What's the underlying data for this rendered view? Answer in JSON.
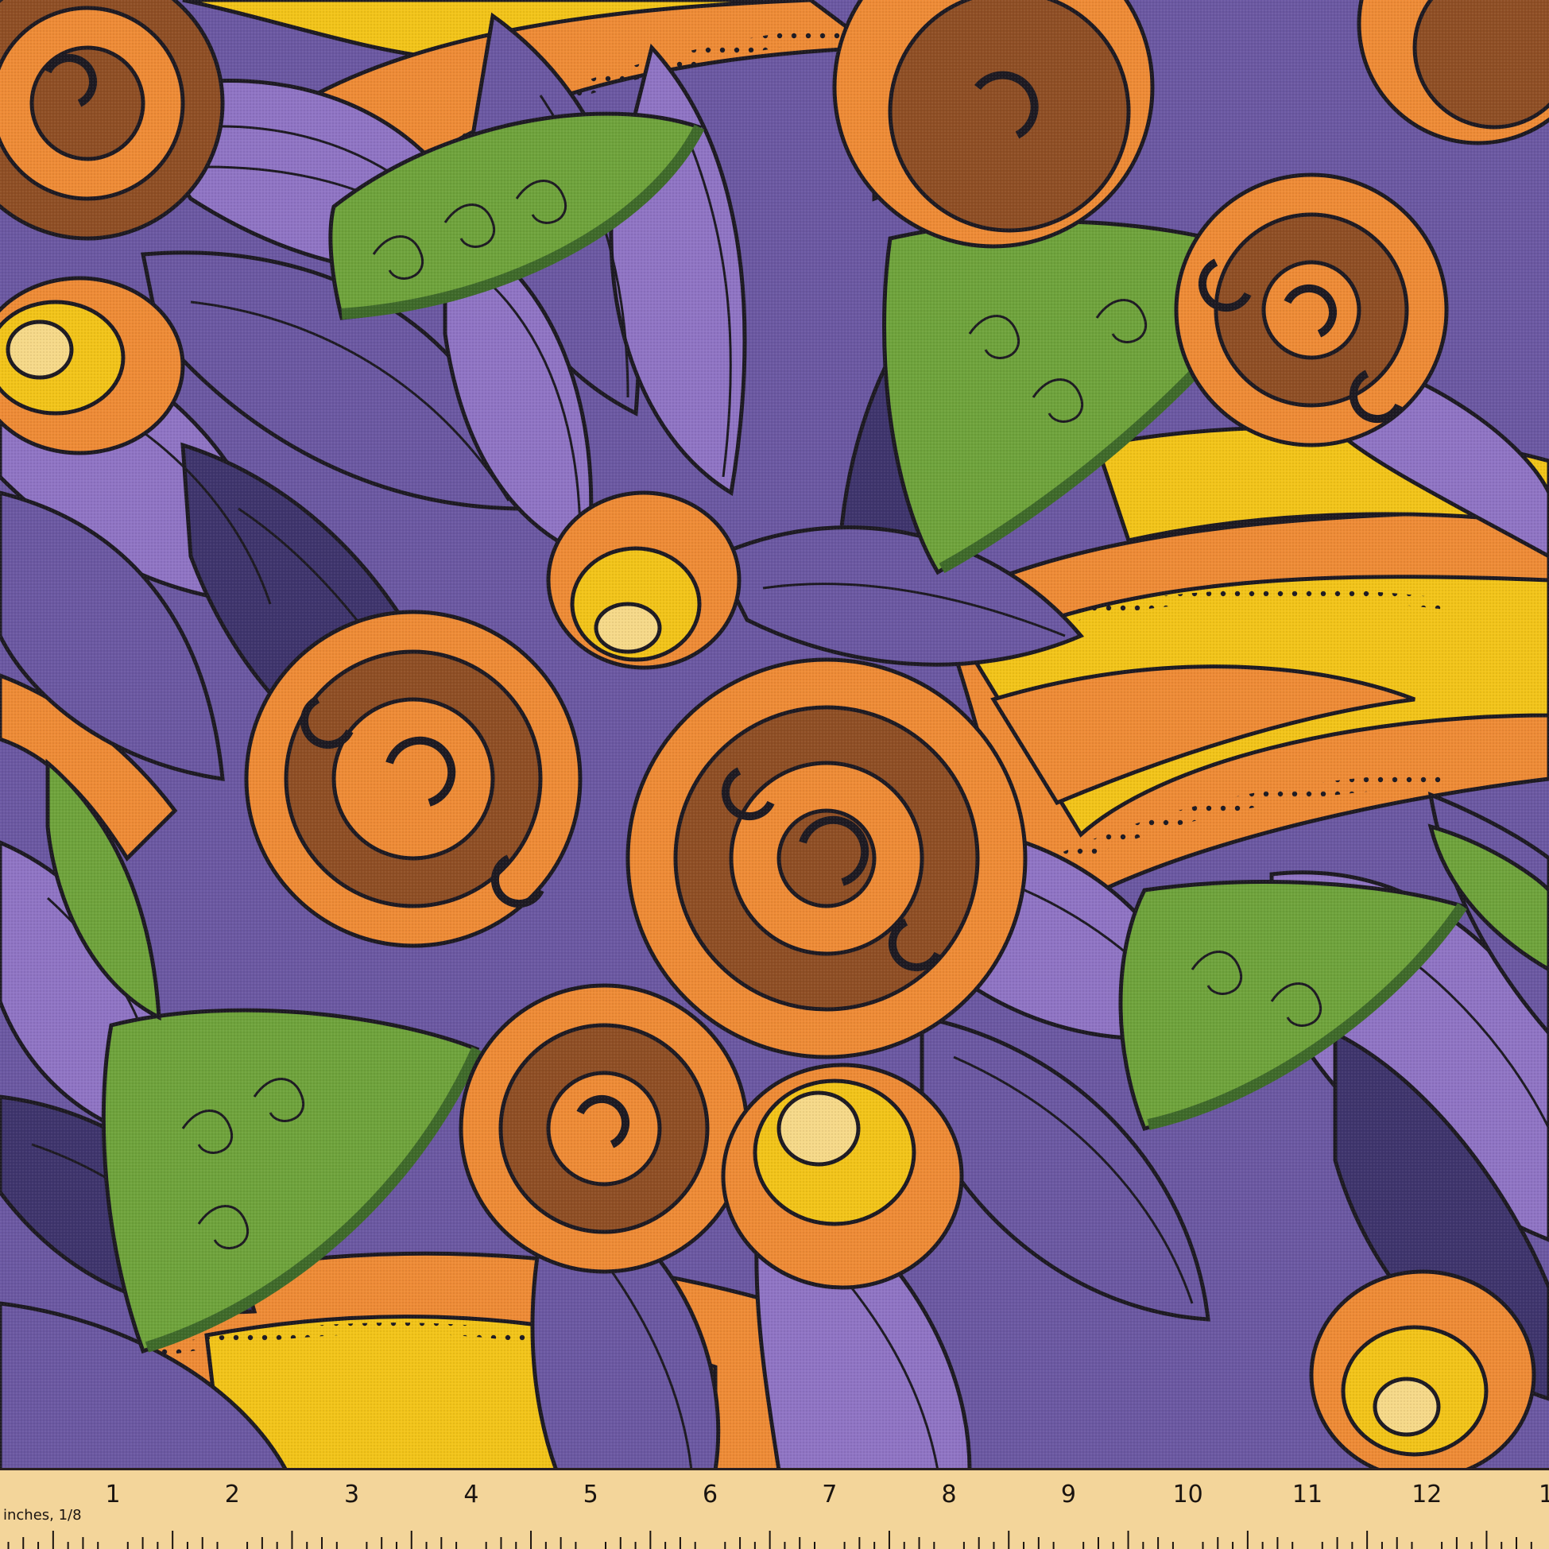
{
  "image": {
    "subject": "fabric-swatch",
    "colors": {
      "purple_light": "#8f74c4",
      "purple_mid": "#6b58a2",
      "purple_dark": "#3f356d",
      "orange": "#ee8b36",
      "orange_dark": "#c9641f",
      "brown": "#8f4f25",
      "yellow": "#f2c419",
      "cream": "#f6d989",
      "green": "#6fa33c",
      "green_dark": "#3f6a2a",
      "outline": "#1d1a22"
    }
  },
  "ruler": {
    "unit_label": "inches, 1/8",
    "numbers": [
      "1",
      "2",
      "3",
      "4",
      "5",
      "6",
      "7",
      "8",
      "9",
      "10",
      "11",
      "12",
      "1"
    ],
    "background_color": "#f3d59a"
  }
}
